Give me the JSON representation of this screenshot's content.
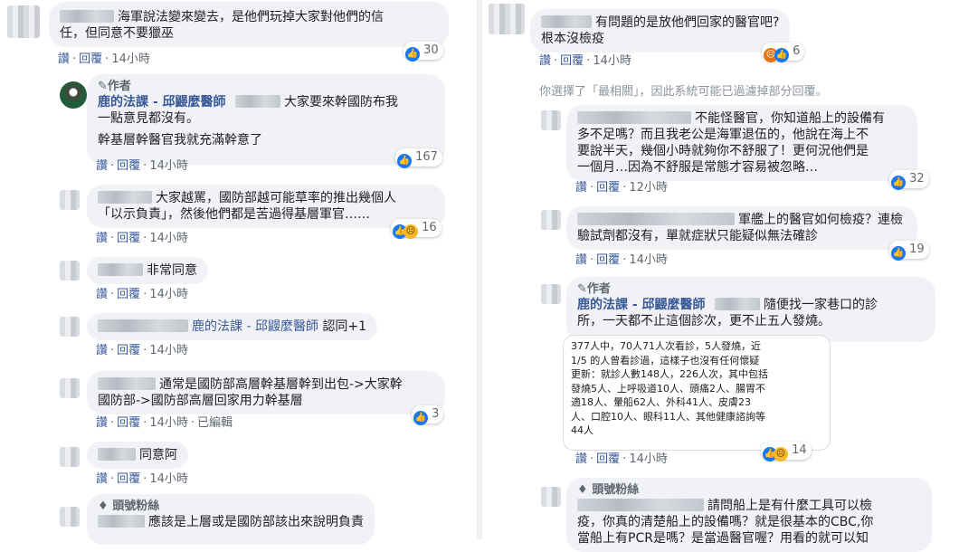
{
  "actions": {
    "like": "讚",
    "reply": "回覆",
    "dot": "·"
  },
  "left": {
    "c1": {
      "text1": "海軍說法變來變去，是他們玩掉大家對他們的信",
      "text2": "任，但同意不要獵巫",
      "time": "14小時",
      "count": "30"
    },
    "c2": {
      "role": "作者",
      "name": "鹿的法課 - 邱鼹麼醫師",
      "text1": "大家要來幹國防布我",
      "text2": "一點意見都沒有。",
      "text3": "幹基層幹醫官我就充滿幹意了",
      "time": "14小時",
      "count": "167"
    },
    "c3": {
      "text1": "大家越罵，國防部越可能草率的推出幾個人",
      "text2": "「以示負責」，然後他們都是苦過得基層軍官……",
      "time": "14小時",
      "count": "16"
    },
    "c4": {
      "text1": "非常同意",
      "time": "14小時"
    },
    "c5": {
      "name": "鹿的法課 - 邱鼹麼醫師",
      "text1": "認同+1",
      "time": "14小時"
    },
    "c6": {
      "text1": "通常是國防部高層幹基層幹到出包->大家幹",
      "text2": "國防部->國防部高層回家用力幹基層",
      "time": "14小時",
      "edited": "已編輯",
      "count": "3"
    },
    "c7": {
      "text1": "同意阿",
      "time": "14小時"
    },
    "c8": {
      "role": "頭號粉絲",
      "text1": "應該是上層或是國防部該出來說明負責"
    }
  },
  "right": {
    "c1": {
      "text1": "有問題的是放他們回家的醫官吧?",
      "text2": "根本沒檢疫",
      "time": "14小時",
      "count": "6"
    },
    "filter": "你選擇了「最相關」，因此系統可能已過濾掉部分回覆。",
    "c2": {
      "text1": "不能怪醫官，你知道船上的設備有",
      "text2": "多不足嗎？而且我老公是海軍退伍的，他說在海上不",
      "text3": "要說半天，幾個小時就夠你不舒服了！更何況他們是",
      "text4": "一個月…因為不舒服是常態才容易被忽略…",
      "time": "12小時",
      "count": "32"
    },
    "c3": {
      "text1": "軍艦上的醫官如何檢疫？連檢",
      "text2": "驗試劑都沒有，單就症狀只能疑似無法確診",
      "time": "14小時",
      "count": "19"
    },
    "c4": {
      "role": "作者",
      "name": "鹿的法課 - 邱鼹麼醫師",
      "text1": "隨便找一家巷口的診",
      "text2": "所，一天都不止這個診次，更不止五人發燒。",
      "lines": [
        "377人中，70人71人次看診，5人發燒，近",
        "1/5 的人曾看診過，這樣子也沒有任何懷疑",
        "更新：就診人數148人，226人次，其中包括",
        "發燒5人、上呼吸道10人、頭痛2人、腸胃不",
        "適18人、暈船62人、外科41人、皮膚23",
        "人、口腔10人、眼科11人、其他健康諮詢等",
        "44人"
      ],
      "time": "14小時",
      "count": "14"
    },
    "c5": {
      "role": "頭號粉絲",
      "text1": "請問船上是有什麼工具可以檢",
      "text2": "疫，你真的清楚船上的設備嗎？就是很基本的CBC,你",
      "text3": "當船上有PCR是嗎？是當過醫官喔？用看的就可以知"
    }
  }
}
